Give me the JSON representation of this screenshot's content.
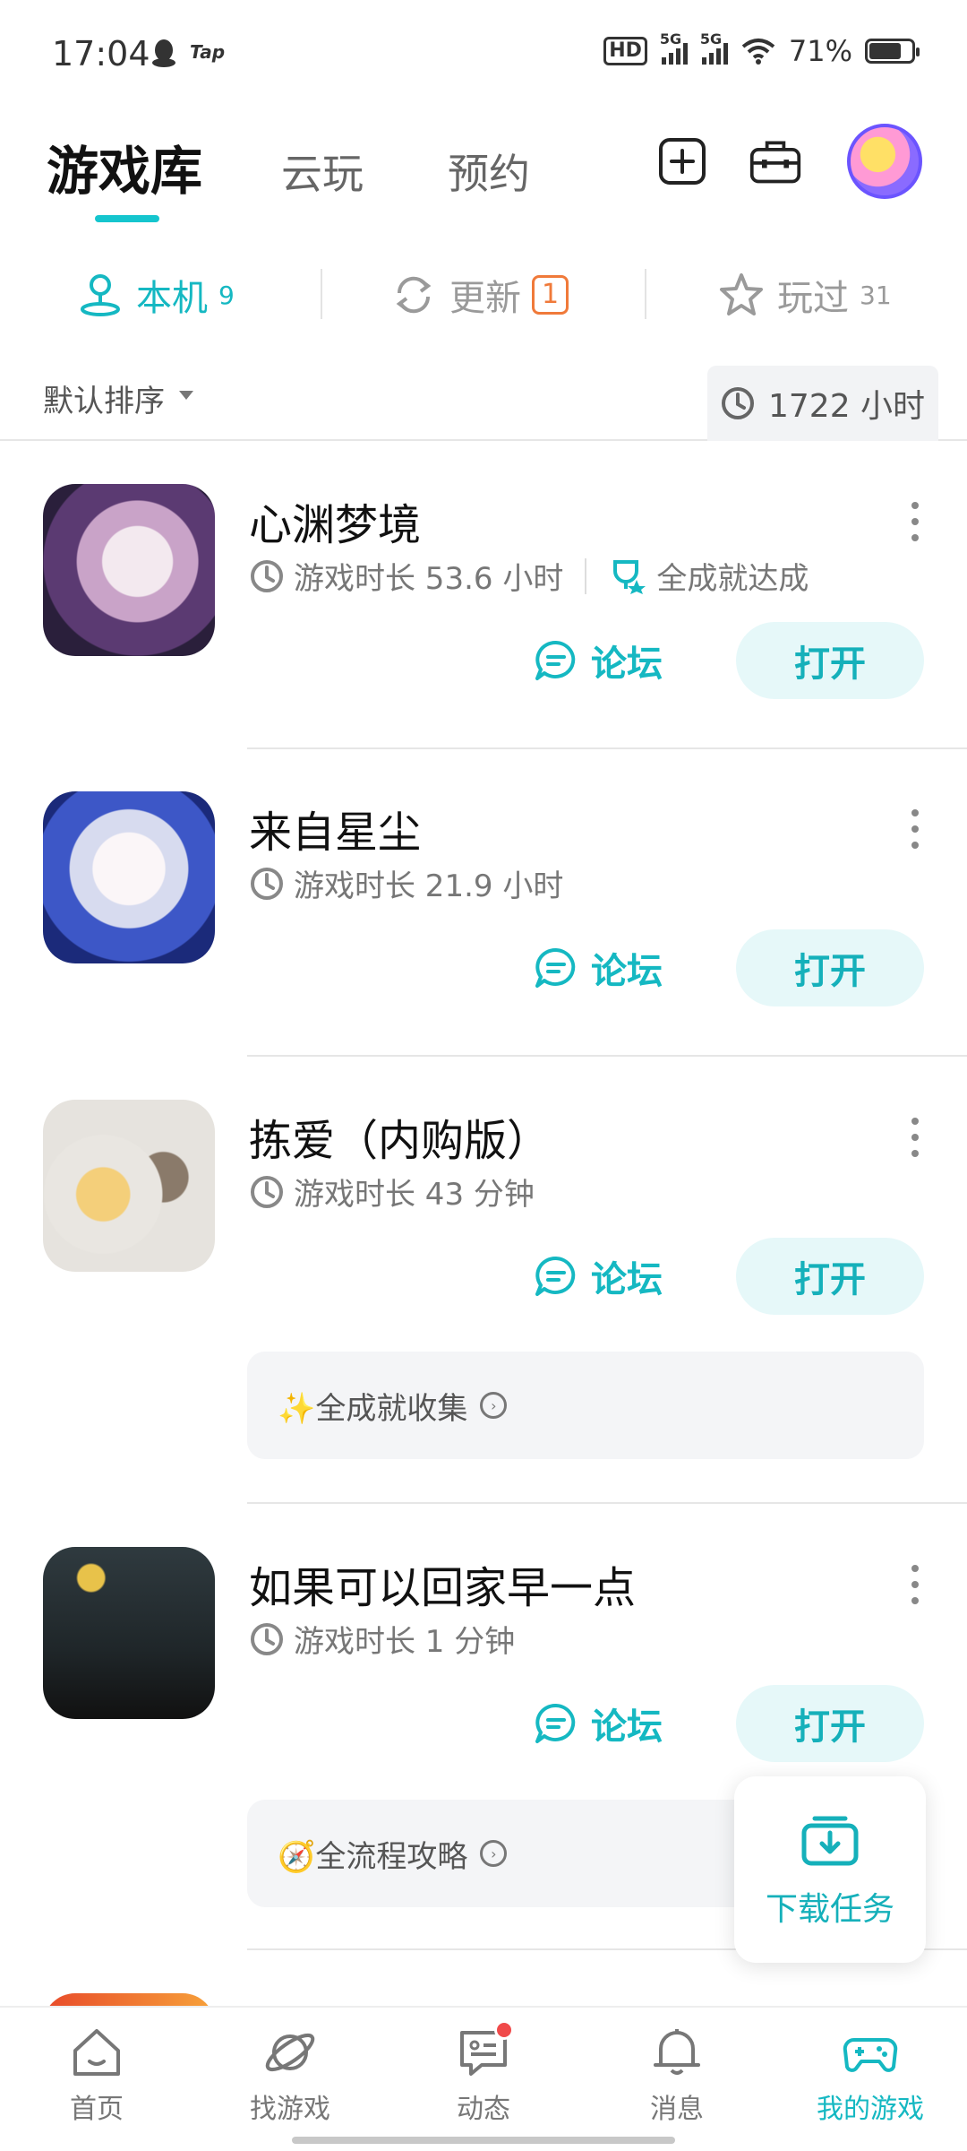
{
  "status_bar": {
    "time": "17:04",
    "tap_label": "Tap",
    "hd_label": "HD",
    "sim1_label": "5G",
    "sim2_label": "5G",
    "battery_text": "71%"
  },
  "header": {
    "tabs": [
      {
        "label": "游戏库",
        "active": true
      },
      {
        "label": "云玩",
        "active": false
      },
      {
        "label": "预约",
        "active": false
      }
    ],
    "icons": [
      "add-icon",
      "toolbox-icon",
      "avatar"
    ]
  },
  "filters": [
    {
      "label": "本机",
      "count": "9",
      "icon": "local-device-icon",
      "active": true
    },
    {
      "label": "更新",
      "count": "1",
      "icon": "refresh-icon",
      "active": false
    },
    {
      "label": "玩过",
      "count": "31",
      "icon": "star-icon",
      "active": false
    }
  ],
  "sort": {
    "label": "默认排序",
    "total_hours": "1722 小时"
  },
  "games": [
    {
      "title": "心渊梦境",
      "playtime": "游戏时长 53.6 小时",
      "achievement": "全成就达成",
      "forum_label": "论坛",
      "open_label": "打开"
    },
    {
      "title": "来自星尘",
      "playtime": "游戏时长 21.9 小时",
      "forum_label": "论坛",
      "open_label": "打开"
    },
    {
      "title": "拣爱（内购版）",
      "playtime": "游戏时长 43 分钟",
      "forum_label": "论坛",
      "open_label": "打开",
      "extra": "✨全成就收集"
    },
    {
      "title": "如果可以回家早一点",
      "playtime": "游戏时长 1 分钟",
      "forum_label": "论坛",
      "open_label": "打开",
      "extra": "🧭全流程攻略"
    }
  ],
  "download_task": {
    "label": "下载任务"
  },
  "bottom_nav": [
    {
      "label": "首页",
      "icon": "home-icon",
      "active": false
    },
    {
      "label": "找游戏",
      "icon": "planet-icon",
      "active": false
    },
    {
      "label": "动态",
      "icon": "chat-icon",
      "active": false,
      "has_dot": true
    },
    {
      "label": "消息",
      "icon": "bell-icon",
      "active": false
    },
    {
      "label": "我的游戏",
      "icon": "gamepad-icon",
      "active": true
    }
  ],
  "colors": {
    "accent": "#15b8c2",
    "update_badge": "#f07a3a",
    "notification_dot": "#f04a4a"
  }
}
